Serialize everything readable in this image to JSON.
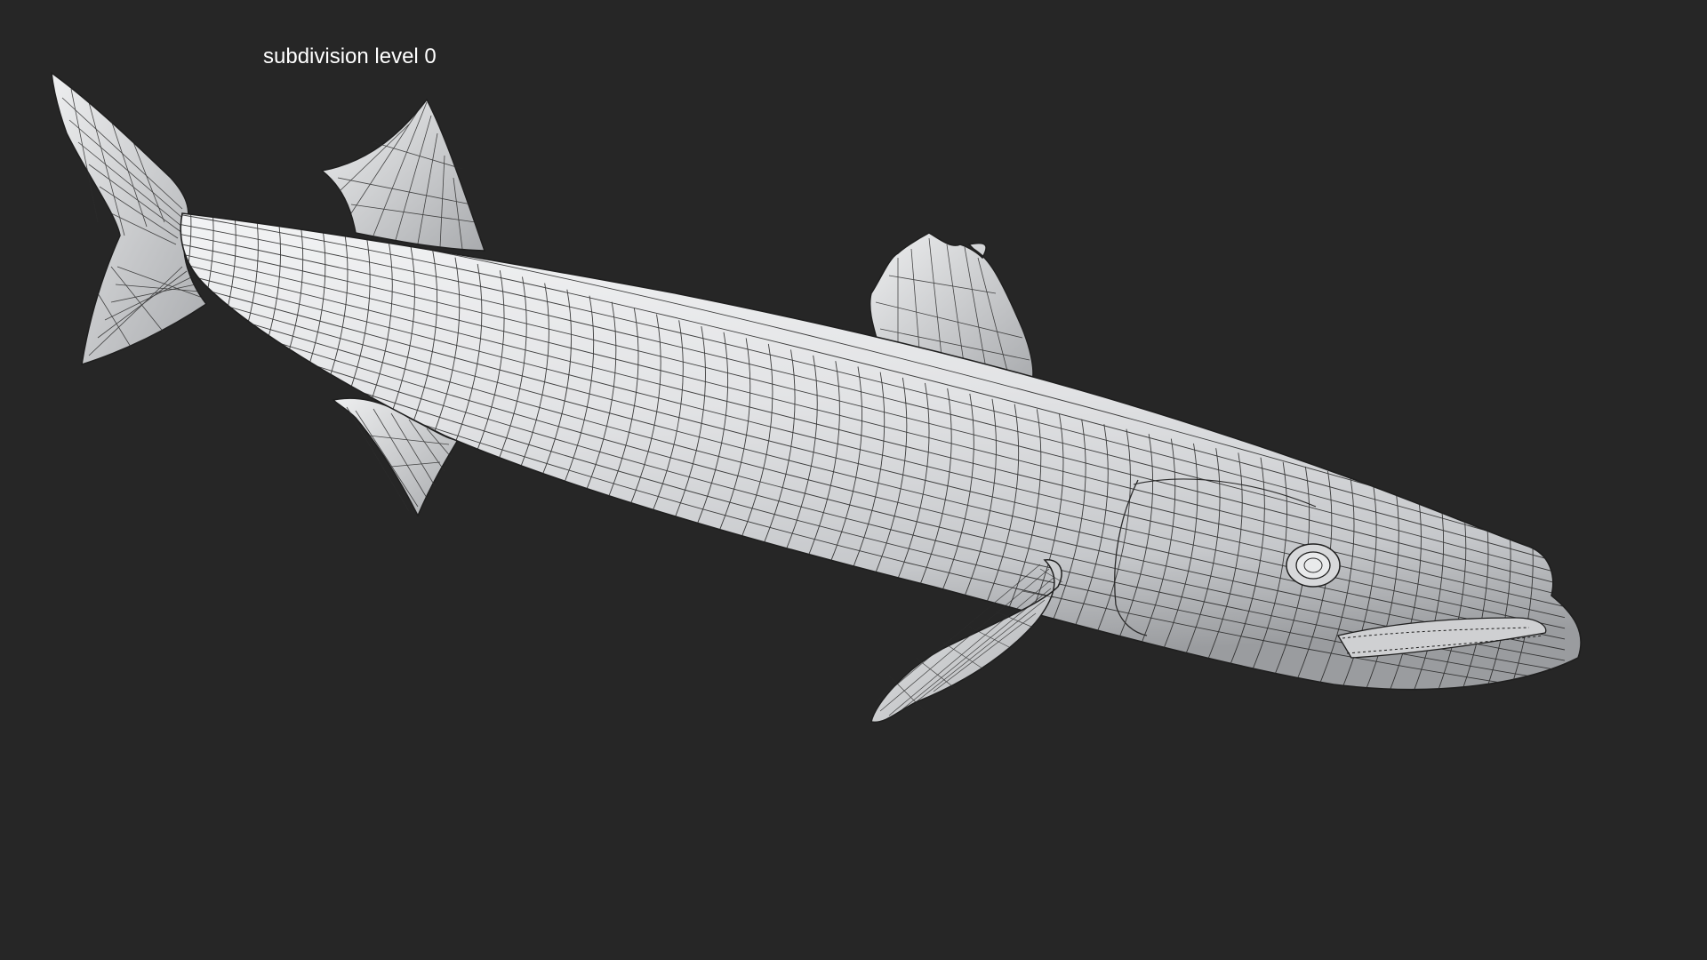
{
  "caption": "subdivision level 0",
  "subject": "barracuda wireframe model",
  "colors": {
    "background": "#262626",
    "mesh_surface": "#e4e5e7",
    "mesh_shadow": "#9a9c9f",
    "wire": "#1f1f1f",
    "caption_text": "#ffffff"
  }
}
